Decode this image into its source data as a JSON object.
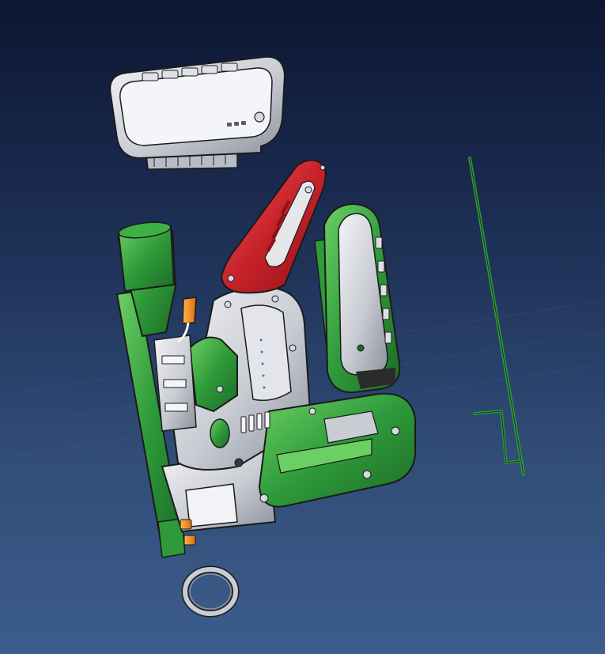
{
  "viewer": {
    "background_top": "#0d1633",
    "background_bottom": "#3c5d8c"
  },
  "colors": {
    "green": "#2e9a3a",
    "green_dark": "#1d6b26",
    "green_light": "#5cc25a",
    "red": "#c8222a",
    "red_dark": "#8e1217",
    "silver": "#c9ccd3",
    "silver_light": "#eef0f4",
    "silver_dark": "#8d929c",
    "orange": "#f08a1c",
    "outline": "#1b1b1b"
  },
  "parts": [
    {
      "id": "battery-pack-top",
      "icon": "battery-icon"
    },
    {
      "id": "side-handle",
      "icon": "handle-icon"
    },
    {
      "id": "dust-tube",
      "icon": "tube-icon"
    },
    {
      "id": "main-housing",
      "icon": "housing-icon"
    },
    {
      "id": "red-top-cover",
      "icon": "cover-icon"
    },
    {
      "id": "rear-grip",
      "icon": "grip-icon"
    },
    {
      "id": "depth-rod",
      "icon": "rod-icon"
    },
    {
      "id": "ring-collar",
      "icon": "ring-icon"
    },
    {
      "id": "orange-switch",
      "icon": "switch-icon"
    }
  ]
}
